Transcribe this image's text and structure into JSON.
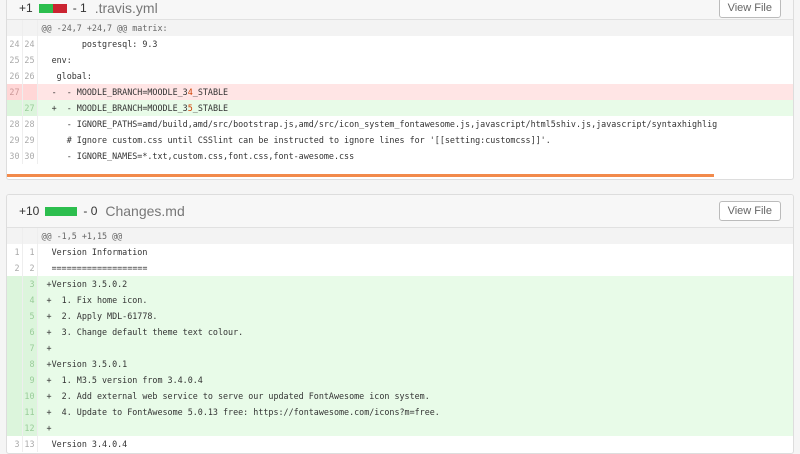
{
  "files": [
    {
      "additions": "+1",
      "deletions": "- 1",
      "bar": {
        "added_fraction": 0.5
      },
      "filename": ".travis.yml",
      "view_label": "View File",
      "lines": [
        {
          "type": "hunk",
          "old": "",
          "new": "",
          "text": "@@ -24,7 +24,7 @@ matrix:"
        },
        {
          "type": "ctx",
          "old": "24",
          "new": "24",
          "text": "        postgresql: 9.3"
        },
        {
          "type": "ctx",
          "old": "25",
          "new": "25",
          "text": "  env:"
        },
        {
          "type": "ctx",
          "old": "26",
          "new": "26",
          "text": "   global:"
        },
        {
          "type": "del",
          "old": "27",
          "new": "",
          "text": "  -  - MOODLE_BRANCH=MOODLE_3",
          "mark": "4",
          "rest": "_STABLE"
        },
        {
          "type": "add",
          "old": "",
          "new": "27",
          "text": "  +  - MOODLE_BRANCH=MOODLE_3",
          "mark": "5",
          "rest": "_STABLE"
        },
        {
          "type": "ctx",
          "old": "28",
          "new": "28",
          "text": "     - IGNORE_PATHS=amd/build,amd/src/bootstrap.js,amd/src/icon_system_fontawesome.js,javascript/html5shiv.js,javascript/syntaxhighlig"
        },
        {
          "type": "ctx",
          "old": "29",
          "new": "29",
          "text": "     # Ignore custom.css until CSSlint can be instructed to ignore lines for '[[setting:customcss]]'."
        },
        {
          "type": "ctx",
          "old": "30",
          "new": "30",
          "text": "     - IGNORE_NAMES=*.txt,custom.css,font.css,font-awesome.css"
        }
      ]
    },
    {
      "additions": "+10",
      "deletions": "- 0",
      "bar": {
        "added_fraction": 1.0
      },
      "filename": "Changes.md",
      "view_label": "View File",
      "lines": [
        {
          "type": "hunk",
          "old": "",
          "new": "",
          "text": "@@ -1,5 +1,15 @@"
        },
        {
          "type": "ctx",
          "old": "1",
          "new": "1",
          "text": "  Version Information"
        },
        {
          "type": "ctx",
          "old": "2",
          "new": "2",
          "text": "  ==================="
        },
        {
          "type": "add",
          "old": "",
          "new": "3",
          "text": " +Version 3.5.0.2"
        },
        {
          "type": "add",
          "old": "",
          "new": "4",
          "text": " +  1. Fix home icon."
        },
        {
          "type": "add",
          "old": "",
          "new": "5",
          "text": " +  2. Apply MDL-61778."
        },
        {
          "type": "add",
          "old": "",
          "new": "6",
          "text": " +  3. Change default theme text colour."
        },
        {
          "type": "add",
          "old": "",
          "new": "7",
          "text": " +"
        },
        {
          "type": "add",
          "old": "",
          "new": "8",
          "text": " +Version 3.5.0.1"
        },
        {
          "type": "add",
          "old": "",
          "new": "9",
          "text": " +  1. M3.5 version from 3.4.0.4"
        },
        {
          "type": "add",
          "old": "",
          "new": "10",
          "text": " +  2. Add external web service to serve our updated FontAwesome icon system."
        },
        {
          "type": "add",
          "old": "",
          "new": "11",
          "text": " +  4. Update to FontAwesome 5.0.13 free: https://fontawesome.com/icons?m=free."
        },
        {
          "type": "add",
          "old": "",
          "new": "12",
          "text": " +"
        },
        {
          "type": "ctx",
          "old": "3",
          "new": "13",
          "text": "  Version 3.4.0.4"
        }
      ]
    }
  ]
}
